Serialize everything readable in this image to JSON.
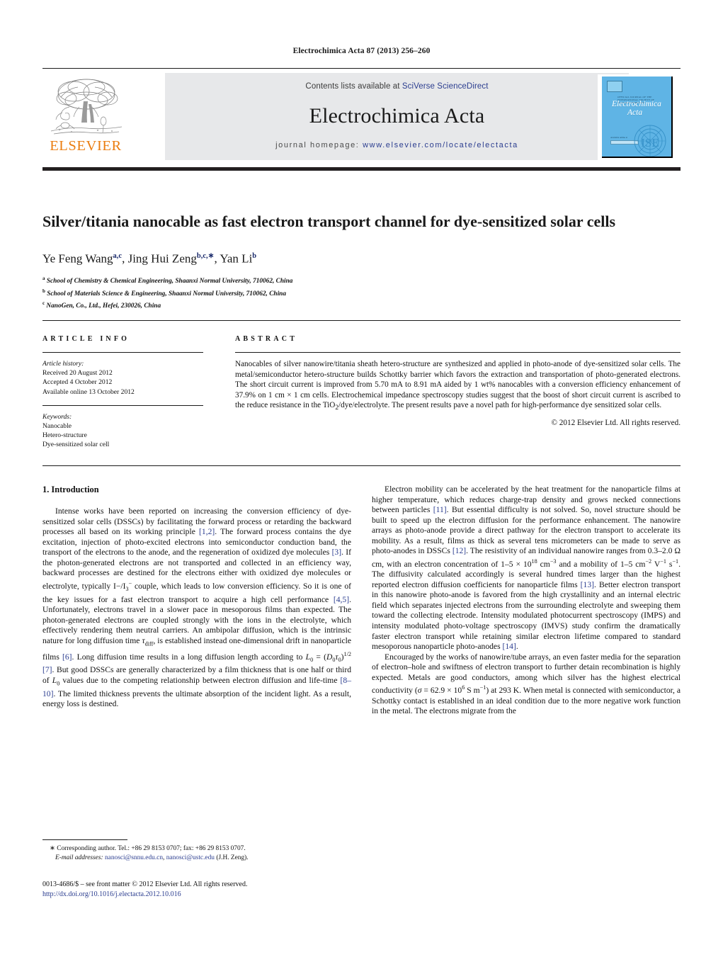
{
  "running_head": "Electrochimica Acta 87 (2013) 256–260",
  "banner": {
    "contents_prefix": "Contents lists available at ",
    "contents_link": "SciVerse ScienceDirect",
    "journal_title": "Electrochimica Acta",
    "homepage_prefix": "journal homepage: ",
    "homepage_link": "www.elsevier.com/locate/electacta",
    "publisher_name": "ELSEVIER",
    "cover": {
      "subhead": "OFFICIAL JOURNAL OF THE INTERNATIONAL SOCIETY OF ELECTROCHEMISTRY",
      "title_line1": "Electrochimica",
      "title_line2": "Acta",
      "footer_note": "Available online at",
      "society_mark": "ISE"
    }
  },
  "article": {
    "title": "Silver/titania nanocable as fast electron transport channel for dye-sensitized solar cells",
    "authors": [
      {
        "name": "Ye Feng Wang",
        "marks": "a,c",
        "sep": ", "
      },
      {
        "name": "Jing Hui Zeng",
        "marks": "b,c,∗",
        "sep": ", "
      },
      {
        "name": "Yan Li",
        "marks": "b",
        "sep": ""
      }
    ],
    "affiliations": [
      {
        "mark": "a",
        "text": "School of Chemistry & Chemical Engineering, Shaanxi Normal University, 710062, China"
      },
      {
        "mark": "b",
        "text": "School of Materials Science & Engineering, Shaanxi Normal University, 710062, China"
      },
      {
        "mark": "c",
        "text": "NanoGen, Co., Ltd., Hefei, 230026, China"
      }
    ]
  },
  "article_info": {
    "heading": "ARTICLE INFO",
    "history_label": "Article history:",
    "history": [
      "Received 20 August 2012",
      "Accepted 4 October 2012",
      "Available online 13 October 2012"
    ],
    "keywords_label": "Keywords:",
    "keywords": [
      "Nanocable",
      "Hetero-structure",
      "Dye-sensitized solar cell"
    ]
  },
  "abstract": {
    "heading": "ABSTRACT",
    "text": "Nanocables of silver nanowire/titania sheath hetero-structure are synthesized and applied in photo-anode of dye-sensitized solar cells. The metal/semiconductor hetero-structure builds Schottky barrier which favors the extraction and transportation of photo-generated electrons. The short circuit current is improved from 5.70 mA to 8.91 mA aided by 1 wt% nanocables with a conversion efficiency enhancement of 37.9% on 1 cm × 1 cm cells. Electrochemical impedance spectroscopy studies suggest that the boost of short circuit current is ascribed to the reduce resistance in the TiO2/dye/electrolyte. The present results pave a novel path for high-performance dye sensitized solar cells.",
    "copyright": "© 2012 Elsevier Ltd. All rights reserved."
  },
  "body": {
    "section_number_title": "1. Introduction",
    "left_paragraphs": [
      "Intense works have been reported on increasing the conversion efficiency of dye-sensitized solar cells (DSSCs) by facilitating the forward process or retarding the backward processes all based on its working principle [1,2]. The forward process contains the dye excitation, injection of photo-excited electrons into semiconductor conduction band, the transport of the electrons to the anode, and the regeneration of oxidized dye molecules [3]. If the photon-generated electrons are not transported and collected in an efficiency way, backward processes are destined for the electrons either with oxidized dye molecules or electrolyte, typically I−/I3− couple, which leads to low conversion efficiency. So it is one of the key issues for a fast electron transport to acquire a high cell performance [4,5]. Unfortunately, electrons travel in a slower pace in mesoporous films than expected. The photon-generated electrons are coupled strongly with the ions in the electrolyte, which effectively rendering them neutral carriers. An ambipolar diffusion, which is the intrinsic nature for long diffusion time τdiff, is established instead one-dimensional drift in nanoparticle films [6]. Long diffusion time results in a long diffusion length according to L0 = (D0τ0)1/2 [7]. But good DSSCs are generally characterized by a film thickness that is one half or third of L0 values due to the competing relationship between electron diffusion and life-time [8–10]. The limited thickness prevents the ultimate absorption of the incident light. As a result, energy loss is destined."
    ],
    "right_paragraphs": [
      "Electron mobility can be accelerated by the heat treatment for the nanoparticle films at higher temperature, which reduces charge-trap density and grows necked connections between particles [11]. But essential difficulty is not solved. So, novel structure should be built to speed up the electron diffusion for the performance enhancement. The nanowire arrays as photo-anode provide a direct pathway for the electron transport to accelerate its mobility. As a result, films as thick as several tens micrometers can be made to serve as photo-anodes in DSSCs [12]. The resistivity of an individual nanowire ranges from 0.3–2.0 Ω cm, with an electron concentration of 1–5 × 1018 cm−3 and a mobility of 1–5 cm−2 V−1 s−1. The diffusivity calculated accordingly is several hundred times larger than the highest reported electron diffusion coefficients for nanoparticle films [13]. Better electron transport in this nanowire photo-anode is favored from the high crystallinity and an internal electric field which separates injected electrons from the surrounding electrolyte and sweeping them toward the collecting electrode. Intensity modulated photocurrent spectroscopy (IMPS) and intensity modulated photo-voltage spectroscopy (IMVS) study confirm the dramatically faster electron transport while retaining similar electron lifetime compared to standard mesoporous nanoparticle photo-anodes [14].",
      "Encouraged by the works of nanowire/tube arrays, an even faster media for the separation of electron–hole and swiftness of electron transport to further detain recombination is highly expected. Metals are good conductors, among which silver has the highest electrical conductivity (σ = 62.9 × 106 S m−1) at 293 K. When metal is connected with semiconductor, a Schottky contact is established in an ideal condition due to the more negative work function in the metal. The electrons migrate from the"
    ]
  },
  "footnotes": {
    "corresponding": "∗ Corresponding author. Tel.: +86 29 8153 0707; fax: +86 29 8153 0707.",
    "email_label": "E-mail addresses:",
    "email_1": "nanosci@snnu.edu.cn",
    "email_2": "nanosci@ustc.edu",
    "email_attrib": "(J.H. Zeng).",
    "issn_line": "0013-4686/$ – see front matter © 2012 Elsevier Ltd. All rights reserved.",
    "doi_line": "http://dx.doi.org/10.1016/j.electacta.2012.10.016"
  },
  "colors": {
    "link_blue": "#2b3d8f",
    "elsevier_orange": "#eb7d10",
    "banner_grey": "#e7e8ea",
    "rule_black": "#231f20",
    "cover_blue": "#5fb4e5"
  }
}
